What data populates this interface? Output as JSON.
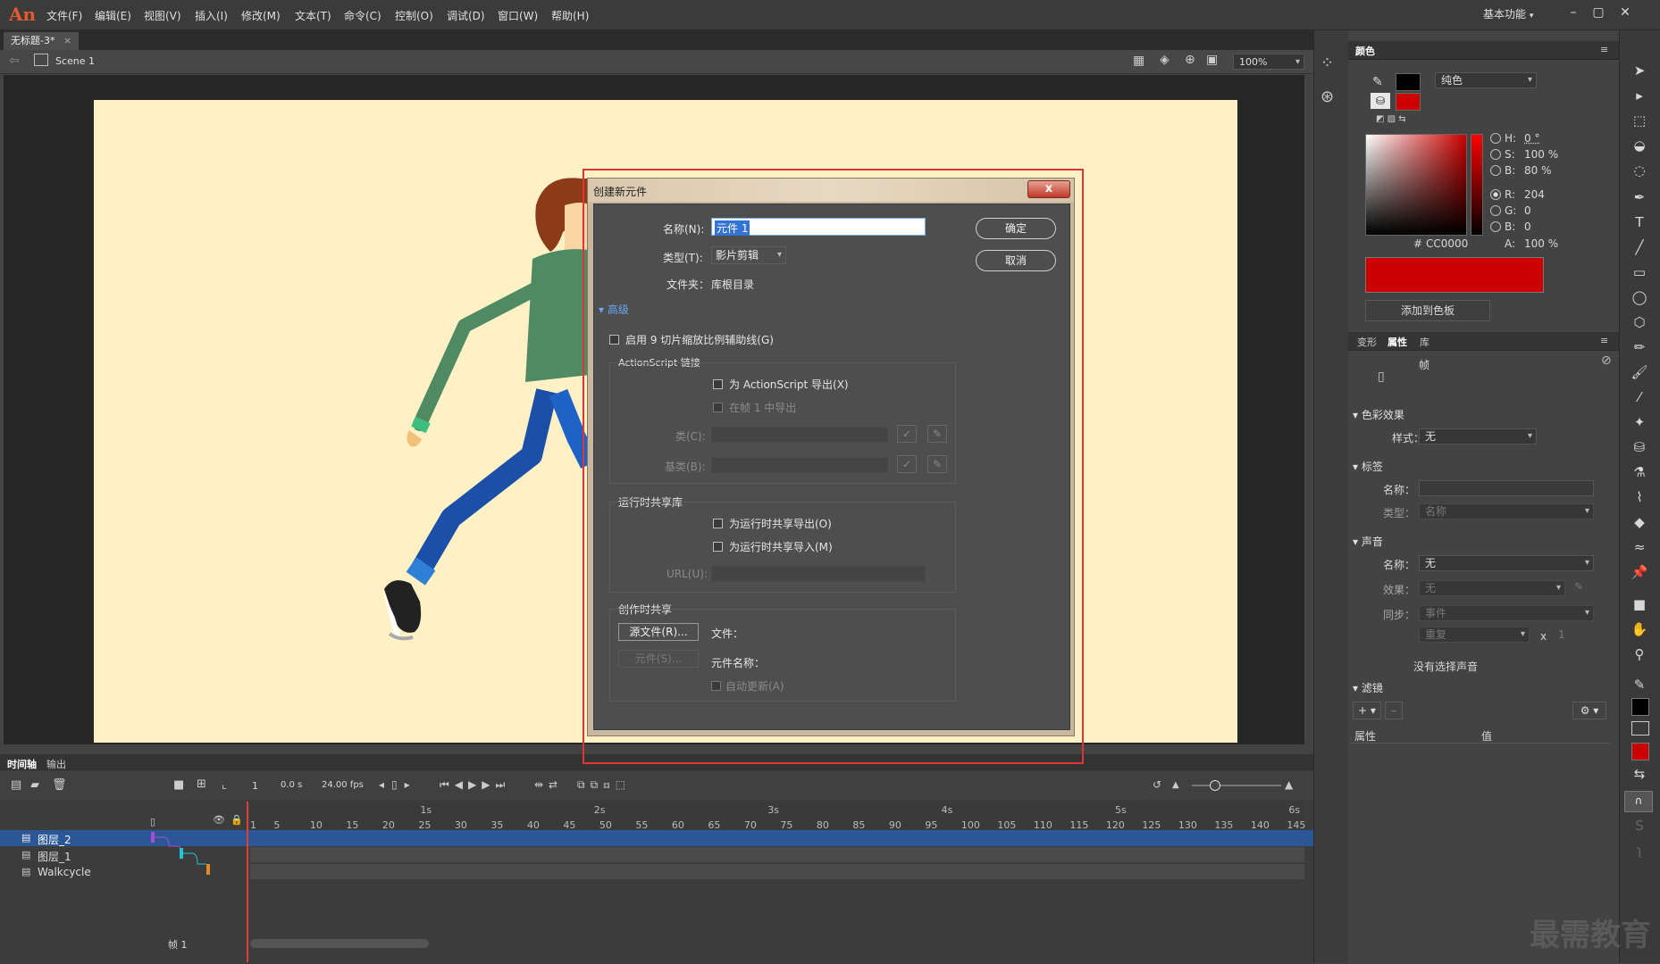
{
  "app": {
    "logo": "An"
  },
  "menu": [
    "文件(F)",
    "编辑(E)",
    "视图(V)",
    "插入(I)",
    "修改(M)",
    "文本(T)",
    "命令(C)",
    "控制(O)",
    "调试(D)",
    "窗口(W)",
    "帮助(H)"
  ],
  "workspace": "基本功能",
  "document": {
    "tab": "无标题-3*",
    "scene": "Scene 1",
    "zoom": "100%"
  },
  "colors": {
    "stage": "#fff1c6",
    "fill": "#cc0000",
    "accent_frame": "#e03535",
    "selected_layer": "#2b5797"
  },
  "color_panel": {
    "tab": "颜色",
    "type": "纯色",
    "h_label": "H:",
    "h_val": "0 °",
    "s_label": "S:",
    "s_val": "100 %",
    "b_label": "B:",
    "b_val": "80 %",
    "r_label": "R:",
    "r_val": "204",
    "g_label": "G:",
    "g_val": "0",
    "b2_label": "B:",
    "b2_val": "0",
    "hex_label": "#",
    "hex_val": "CC0000",
    "a_label": "A:",
    "a_val": "100 %",
    "add_swatch": "添加到色板"
  },
  "props_panel": {
    "tabs": [
      "变形",
      "属性",
      "库"
    ],
    "active_tab": "属性",
    "frame_label": "帧",
    "color_effect": "色彩效果",
    "style_label": "样式：",
    "style_val": "无",
    "label_section": "标签",
    "name_label": "名称：",
    "type_label": "类型：",
    "type_val": "名称",
    "sound_section": "声音",
    "sound_name_label": "名称：",
    "sound_name_val": "无",
    "effect_label": "效果：",
    "effect_val": "无",
    "sync_label": "同步：",
    "sync_val": "事件",
    "repeat_val": "重复",
    "repeat_x": "x",
    "repeat_count": "1",
    "no_sound": "没有选择声音",
    "filter_section": "滤镜",
    "col_prop": "属性",
    "col_val": "值"
  },
  "timeline": {
    "tabs": [
      "时间轴",
      "输出"
    ],
    "frame": "1",
    "time": "0.0 s",
    "fps": "24.00 fps",
    "ruler_seconds": [
      "1s",
      "2s",
      "3s",
      "4s",
      "5s",
      "6s"
    ],
    "ruler_frames": [
      "1",
      "5",
      "10",
      "15",
      "20",
      "25",
      "30",
      "35",
      "40",
      "45",
      "50",
      "55",
      "60",
      "65",
      "70",
      "75",
      "80",
      "85",
      "90",
      "95",
      "100",
      "105",
      "110",
      "115",
      "120",
      "125",
      "130",
      "135",
      "140",
      "145"
    ],
    "layers": [
      {
        "name": "图层_2",
        "selected": true
      },
      {
        "name": "图层_1",
        "selected": false
      },
      {
        "name": "Walkcycle",
        "selected": false
      }
    ],
    "footer": "帧 1"
  },
  "dialog": {
    "title": "创建新元件",
    "close": "x",
    "name_label": "名称(N):",
    "name_val": "元件 1",
    "type_label": "类型(T):",
    "type_val": "影片剪辑",
    "folder_label": "文件夹：",
    "folder_val": "库根目录",
    "advanced": "高级",
    "scale9": "启用 9 切片缩放比例辅助线(G)",
    "ok": "确定",
    "cancel": "取消",
    "as_group": "ActionScript 链接",
    "as_export": "为 ActionScript 导出(X)",
    "as_frame1": "在帧 1 中导出",
    "class_label": "类(C):",
    "base_label": "基类(B):",
    "runtime_group": "运行时共享库",
    "rt_export": "为运行时共享导出(O)",
    "rt_import": "为运行时共享导入(M)",
    "url_label": "URL(U):",
    "author_group": "创作时共享",
    "source_btn": "源文件(R)...",
    "file_label": "文件：",
    "symbol_btn": "元件(S)...",
    "symbol_name_label": "元件名称：",
    "auto_update": "自动更新(A)"
  },
  "watermark": "最需教育"
}
